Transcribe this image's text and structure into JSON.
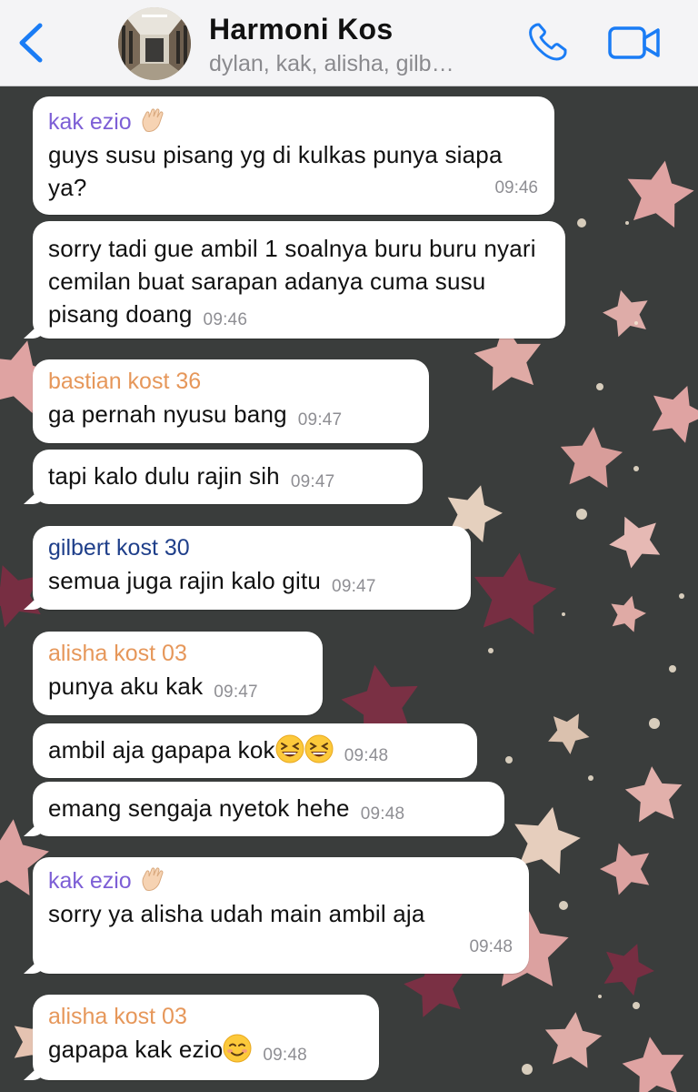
{
  "header": {
    "back_icon": "chevron-left-icon",
    "title": "Harmoni Kos",
    "subtitle": "dylan, kak, alisha, gilb…",
    "call_icon": "phone-icon",
    "video_icon": "video-camera-icon"
  },
  "colors": {
    "ios_blue": "#1a7cf5",
    "sender_purple": "#7d5fd6",
    "sender_orange": "#e6975a",
    "sender_navy": "#1f3f8a",
    "timestamp_gray": "#8e8e93",
    "chat_background": "#3a3d3c"
  },
  "messages": [
    {
      "sender": "kak ezio",
      "sender_emoji": "waving-hand",
      "text": "guys susu pisang yg di kulkas punya siapa ya?",
      "time": "09:46"
    },
    {
      "text": "sorry tadi gue ambil 1 soalnya buru buru nyari cemilan buat sarapan adanya cuma susu pisang doang",
      "time": "09:46"
    },
    {
      "sender": "bastian kost 36",
      "text": "ga pernah nyusu bang",
      "time": "09:47"
    },
    {
      "text": "tapi kalo dulu rajin sih",
      "time": "09:47"
    },
    {
      "sender": "gilbert kost 30",
      "text": "semua juga rajin kalo gitu",
      "time": "09:47"
    },
    {
      "sender": "alisha kost 03",
      "text": "punya aku kak",
      "time": "09:47"
    },
    {
      "text": "ambil aja gapapa kok",
      "emoji": "grinning-squinting-face x2",
      "time": "09:48"
    },
    {
      "text": "emang sengaja nyetok hehe",
      "time": "09:48"
    },
    {
      "sender": "kak ezio",
      "sender_emoji": "waving-hand",
      "text": "sorry ya alisha udah main ambil aja",
      "time": "09:48"
    },
    {
      "sender": "alisha kost 03",
      "text": "gapapa kak ezio",
      "emoji": "smiling-face",
      "time": "09:48"
    }
  ]
}
